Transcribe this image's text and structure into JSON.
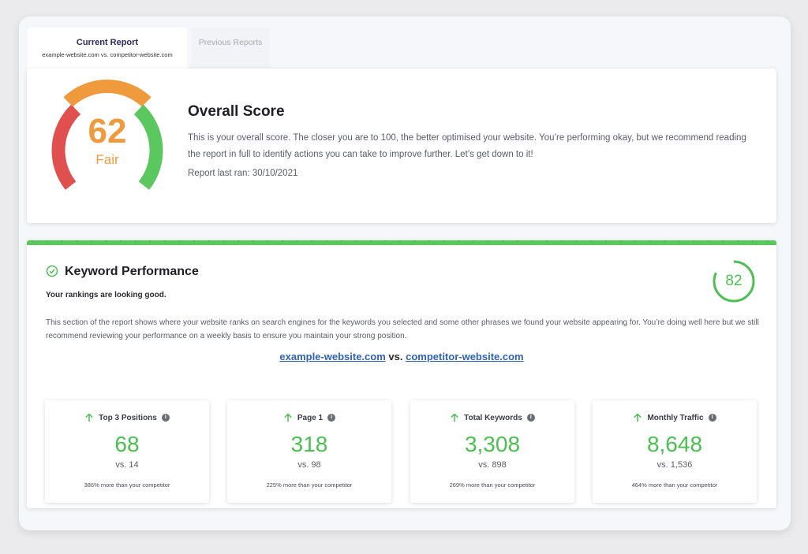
{
  "tabs": {
    "current": {
      "title": "Current Report",
      "subtitle": "example-website.com vs. competitor-website.com"
    },
    "previous": {
      "title": "Previous Reports"
    }
  },
  "overall": {
    "score": "62",
    "rating": "Fair",
    "title": "Overall Score",
    "description": "This is your overall score. The closer you are to 100, the better optimised your website. You’re performing okay, but we recommend reading the report in full to identify actions you can take to improve further. Let’s get down to it!",
    "last_ran": "Report last ran: 30/10/2021",
    "gauge_colors": {
      "low": "#e0504f",
      "mid": "#f09a3e",
      "high": "#5ac85e"
    }
  },
  "keyword_performance": {
    "title": "Keyword Performance",
    "subtitle": "Your rankings are looking good.",
    "score": "82",
    "score_fraction": 0.82,
    "description": "This section of the report shows where your website ranks on search engines for the keywords you selected and some other phrases we found your website appearing for. You’re doing well here but we still recommend reviewing your performance on a weekly basis to ensure you maintain your strong position.",
    "site": "example-website.com",
    "vs_word": "vs.",
    "competitor": "competitor-website.com",
    "accent_color": "#4cbf53",
    "stats": [
      {
        "label": "Top 3 Positions",
        "value": "68",
        "vs": "vs. 14",
        "note": "386% more than your competitor"
      },
      {
        "label": "Page 1",
        "value": "318",
        "vs": "vs. 98",
        "note": "225% more than your competitor"
      },
      {
        "label": "Total Keywords",
        "value": "3,308",
        "vs": "vs. 898",
        "note": "269% more than your competitor"
      },
      {
        "label": "Monthly Traffic",
        "value": "8,648",
        "vs": "vs. 1,536",
        "note": "464% more than your competitor"
      }
    ]
  },
  "icons": {
    "info": "i",
    "check": "check-circle-icon",
    "arrow_up": "arrow-up-icon"
  }
}
